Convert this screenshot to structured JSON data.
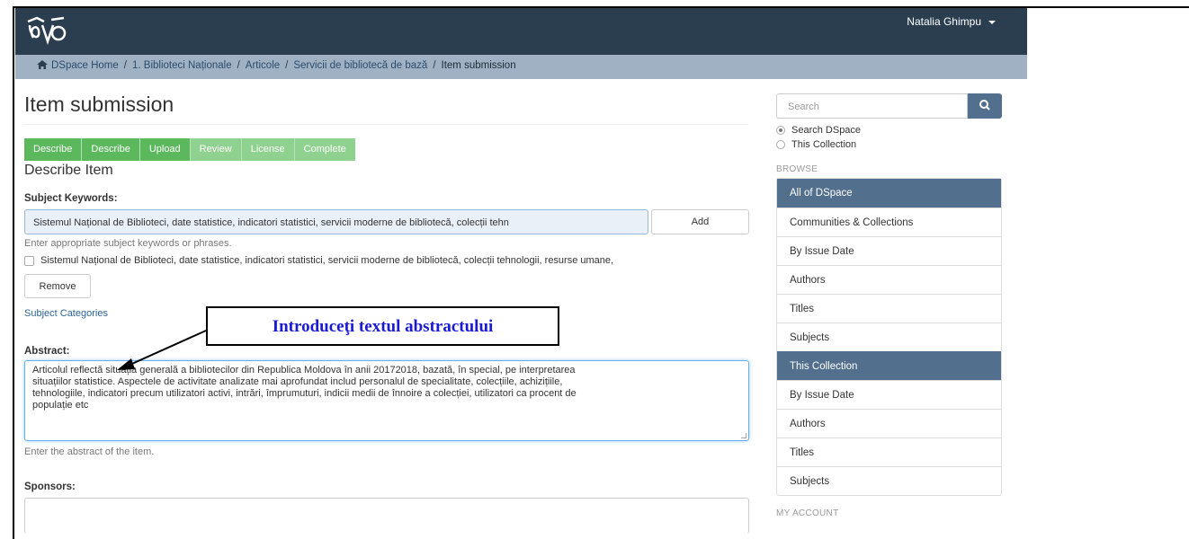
{
  "navbar": {
    "user_name": "Natalia Ghimpu"
  },
  "breadcrumb": [
    "DSpace Home",
    "1. Biblioteci Naționale",
    "Articole",
    "Servicii de bibliotecă de bază",
    "Item submission"
  ],
  "page": {
    "title": "Item submission",
    "section_title": "Describe Item"
  },
  "steps": [
    {
      "label": "Describe",
      "state": "done"
    },
    {
      "label": "Describe",
      "state": "done"
    },
    {
      "label": "Upload",
      "state": "done"
    },
    {
      "label": "Review",
      "state": "todo"
    },
    {
      "label": "License",
      "state": "todo"
    },
    {
      "label": "Complete",
      "state": "todo"
    }
  ],
  "subject": {
    "label": "Subject Keywords:",
    "input_value": "Sistemul Național de Biblioteci, date statistice, indicatori statistici, servicii moderne de bibliotecă, colecții tehn",
    "add_label": "Add",
    "help": "Enter appropriate subject keywords or phrases.",
    "checkbox_item": "Sistemul Național de Biblioteci, date statistice, indicatori statistici, servicii moderne de bibliotecă, colecții tehnologii, resurse umane,",
    "remove_label": "Remove",
    "categories_link": "Subject Categories"
  },
  "abstract": {
    "label": "Abstract:",
    "lines": [
      "Articolul reflectă situația generală a bibliotecilor din Republica Moldova în anii 20172018, bazată, în special, pe interpretarea",
      "situațiilor statistice. Aspectele de activitate analizate mai aprofundat includ personalul de specialitate, colecțiile, achizițiile,",
      "tehnologiile, indicatori precum utilizatori activi, intrări, împrumuturi, indicii medii de înnoire a colecției, utilizatori ca procent de",
      "populație etc"
    ],
    "help": "Enter the abstract of the item."
  },
  "sponsors": {
    "label": "Sponsors:"
  },
  "callout": {
    "text": "Introduceţi textul abstractului"
  },
  "sidebar": {
    "search_placeholder": "Search",
    "scope_options": [
      {
        "label": "Search DSpace",
        "checked": true
      },
      {
        "label": "This Collection",
        "checked": false
      }
    ],
    "browse_heading": "BROWSE",
    "browse_items": [
      {
        "label": "All of DSpace",
        "active": true
      },
      {
        "label": "Communities & Collections",
        "active": false
      },
      {
        "label": "By Issue Date",
        "active": false
      },
      {
        "label": "Authors",
        "active": false
      },
      {
        "label": "Titles",
        "active": false
      },
      {
        "label": "Subjects",
        "active": false
      },
      {
        "label": "This Collection",
        "active": true
      },
      {
        "label": "By Issue Date",
        "active": false
      },
      {
        "label": "Authors",
        "active": false
      },
      {
        "label": "Titles",
        "active": false
      },
      {
        "label": "Subjects",
        "active": false
      }
    ],
    "account_heading": "MY ACCOUNT"
  },
  "colors": {
    "navbar": "#2b3e50",
    "breadcrumb": "#9fb1c3",
    "step_done": "#5cb85c",
    "step_todo": "#8fd18f",
    "list_active": "#526f8d",
    "callout_text": "#1a1ad6"
  },
  "icons": [
    "logo-icon",
    "home-icon",
    "caret-down-icon",
    "search-icon",
    "arrow-icon"
  ]
}
